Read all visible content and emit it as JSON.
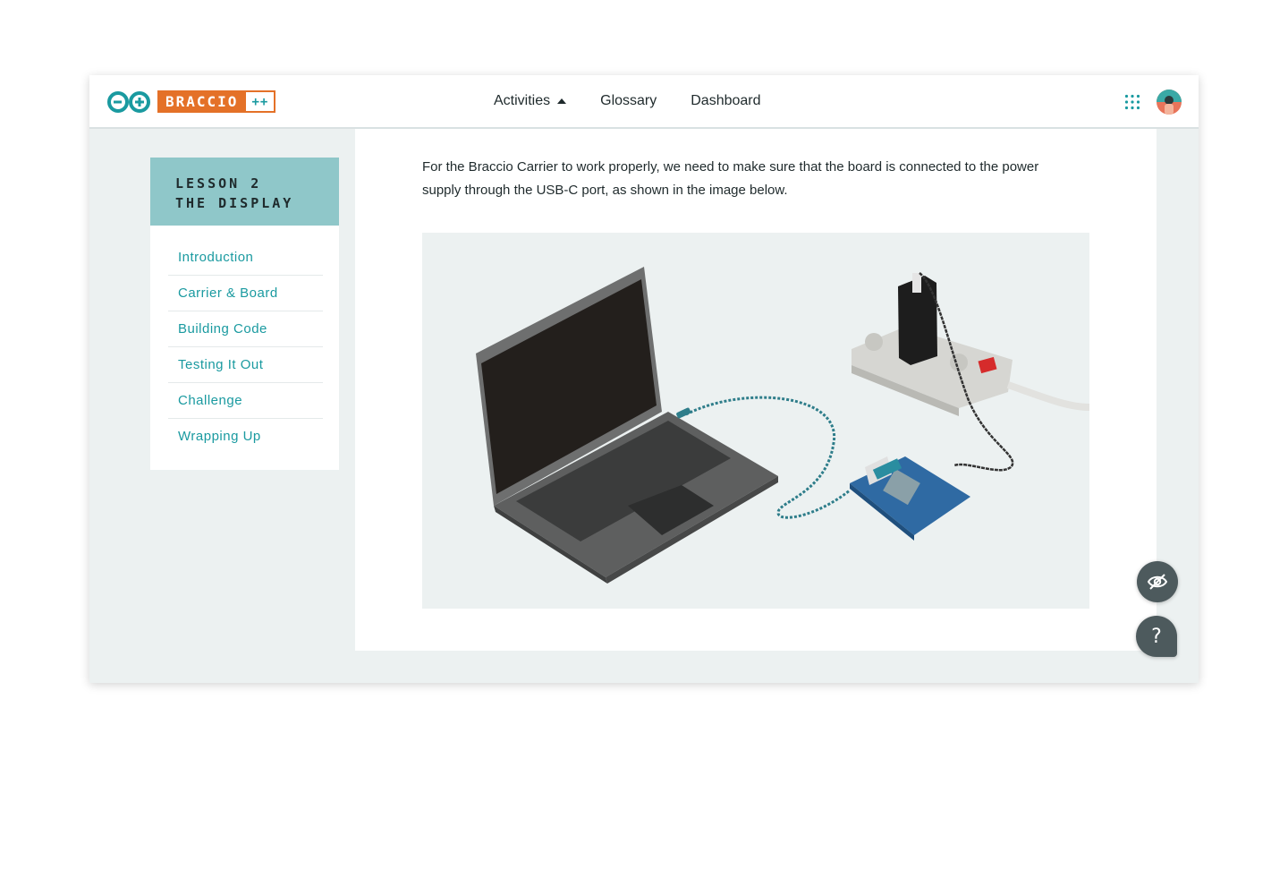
{
  "header": {
    "brand_name": "BRACCIO",
    "brand_suffix": "++",
    "nav": [
      {
        "label": "Activities",
        "has_caret": true
      },
      {
        "label": "Glossary"
      },
      {
        "label": "Dashboard"
      }
    ],
    "icons": [
      "arduino-logo-icon",
      "apps-grid-icon",
      "avatar"
    ]
  },
  "sidebar": {
    "lesson_number": "LESSON 2",
    "lesson_title": "THE DISPLAY",
    "items": [
      {
        "label": "Introduction"
      },
      {
        "label": "Carrier & Board"
      },
      {
        "label": "Building Code"
      },
      {
        "label": "Testing It Out"
      },
      {
        "label": "Challenge"
      },
      {
        "label": "Wrapping Up"
      }
    ]
  },
  "main": {
    "paragraph": "For the Braccio Carrier to work properly, we need to make sure that the board is connected to the power supply through the USB-C port, as shown in the image below."
  },
  "fabs": {
    "hide_icon": "eye-off-icon",
    "help_label": "?"
  },
  "colors": {
    "accent_teal": "#1a9aa0",
    "brand_orange": "#e47128",
    "lesson_header_bg": "#8fc7c9",
    "page_bg": "#ecf1f1",
    "fab_bg": "#4d5a5d"
  }
}
